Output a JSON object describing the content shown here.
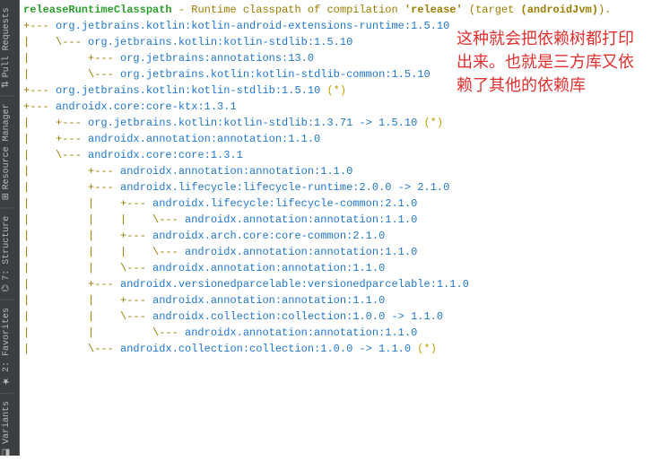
{
  "sidebar": {
    "tabs": [
      {
        "icon": "⇅",
        "label": "Pull Requests"
      },
      {
        "icon": "⊞",
        "label": "Resource Manager"
      },
      {
        "icon": "⌬",
        "label": "7: Structure"
      },
      {
        "icon": "★",
        "label": "2: Favorites"
      },
      {
        "icon": "◧",
        "label": "Variants"
      }
    ]
  },
  "header": {
    "name": "releaseRuntimeClasspath",
    "sep": " - ",
    "desc_prefix": "Runtime classpath of compilation ",
    "release": "'release'",
    "target_label": " (target  ",
    "target_value": "(androidJvm)",
    "target_close": ")."
  },
  "tree_lines": [
    {
      "conn": "+--- ",
      "text": "org.jetbrains.kotlin:kotlin-android-extensions-runtime:1.5.10"
    },
    {
      "conn": "|    \\--- ",
      "text": "org.jetbrains.kotlin:kotlin-stdlib:1.5.10"
    },
    {
      "conn": "|         +--- ",
      "text": "org.jetbrains:annotations:13.0"
    },
    {
      "conn": "|         \\--- ",
      "text": "org.jetbrains.kotlin:kotlin-stdlib-common:1.5.10"
    },
    {
      "conn": "+--- ",
      "text": "org.jetbrains.kotlin:kotlin-stdlib:1.5.10 ",
      "suffix": "(*)"
    },
    {
      "conn": "+--- ",
      "text": "androidx.core:core-ktx:1.3.1"
    },
    {
      "conn": "|    +--- ",
      "text": "org.jetbrains.kotlin:kotlin-stdlib:1.3.71 -> 1.5.10 ",
      "suffix": "(*)"
    },
    {
      "conn": "|    +--- ",
      "text": "androidx.annotation:annotation:1.1.0"
    },
    {
      "conn": "|    \\--- ",
      "text": "androidx.core:core:1.3.1"
    },
    {
      "conn": "|         +--- ",
      "text": "androidx.annotation:annotation:1.1.0"
    },
    {
      "conn": "|         +--- ",
      "text": "androidx.lifecycle:lifecycle-runtime:2.0.0 -> 2.1.0"
    },
    {
      "conn": "|         |    +--- ",
      "text": "androidx.lifecycle:lifecycle-common:2.1.0"
    },
    {
      "conn": "|         |    |    \\--- ",
      "text": "androidx.annotation:annotation:1.1.0"
    },
    {
      "conn": "|         |    +--- ",
      "text": "androidx.arch.core:core-common:2.1.0"
    },
    {
      "conn": "|         |    |    \\--- ",
      "text": "androidx.annotation:annotation:1.1.0"
    },
    {
      "conn": "|         |    \\--- ",
      "text": "androidx.annotation:annotation:1.1.0"
    },
    {
      "conn": "|         +--- ",
      "text": "androidx.versionedparcelable:versionedparcelable:1.1.0"
    },
    {
      "conn": "|         |    +--- ",
      "text": "androidx.annotation:annotation:1.1.0"
    },
    {
      "conn": "|         |    \\--- ",
      "text": "androidx.collection:collection:1.0.0 -> 1.1.0"
    },
    {
      "conn": "|         |         \\--- ",
      "text": "androidx.annotation:annotation:1.1.0"
    },
    {
      "conn": "|         \\--- ",
      "text": "androidx.collection:collection:1.0.0 -> 1.1.0 ",
      "suffix": "(*)"
    }
  ],
  "annotation": "这种就会把依赖树都打印出来。也就是三方库又依赖了其他的依赖库"
}
